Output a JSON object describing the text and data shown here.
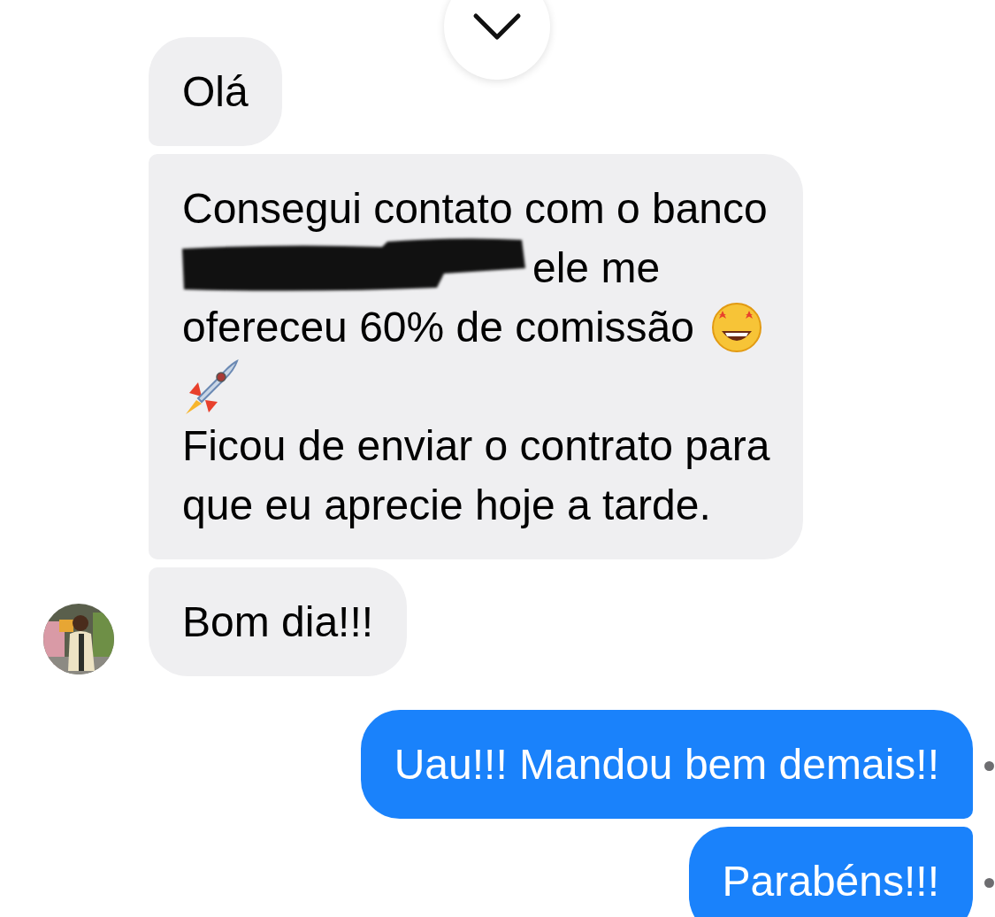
{
  "messages": [
    {
      "kind": "received",
      "avatar": false,
      "lines": [
        [
          {
            "kind": "text",
            "text": "Olá"
          }
        ]
      ]
    },
    {
      "kind": "received",
      "avatar": false,
      "lines": [
        [
          {
            "kind": "text",
            "text": "Consegui contato com o banco"
          }
        ],
        [
          {
            "kind": "redaction"
          },
          {
            "kind": "text",
            "text": "ele me"
          }
        ],
        [
          {
            "kind": "text",
            "text": "ofereceu 60% de comissão"
          },
          {
            "kind": "face"
          }
        ],
        [
          {
            "kind": "rocket"
          }
        ],
        [
          {
            "kind": "text",
            "text": "Ficou de enviar o contrato para"
          }
        ],
        [
          {
            "kind": "text",
            "text": "que eu aprecie hoje a tarde."
          }
        ]
      ]
    },
    {
      "kind": "received",
      "avatar": true,
      "lines": [
        [
          {
            "kind": "text",
            "text": "Bom dia!!!"
          }
        ]
      ]
    },
    {
      "kind": "sent",
      "delivered": true,
      "lines": [
        [
          {
            "kind": "text",
            "text": "Uau!!! Mandou bem demais!!"
          }
        ]
      ]
    },
    {
      "kind": "sent",
      "delivered": true,
      "lines": [
        [
          {
            "kind": "text",
            "text": "Parabéns!!!"
          }
        ]
      ]
    }
  ]
}
